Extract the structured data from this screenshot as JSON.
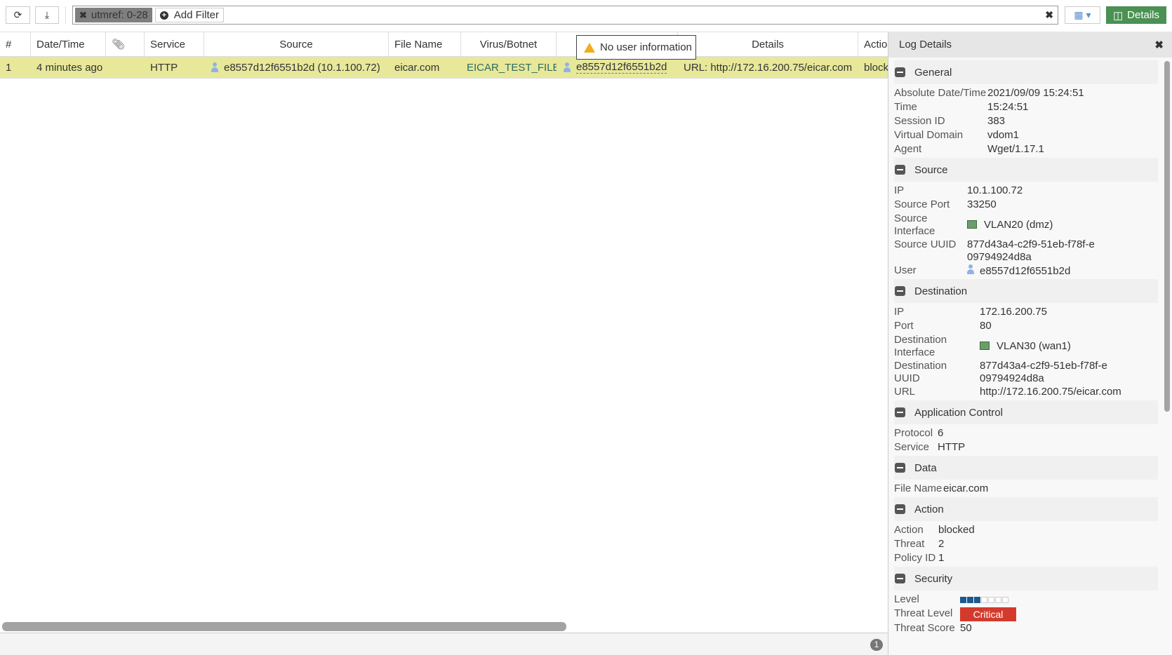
{
  "toolbar": {
    "filter_chip": "utmref: 0-28",
    "add_filter": "Add Filter",
    "details_label": "Details"
  },
  "table": {
    "columns": [
      "#",
      "Date/Time",
      "",
      "Service",
      "Source",
      "File Name",
      "Virus/Botnet",
      "",
      "Details",
      "Actio"
    ],
    "rows": [
      {
        "num": "1",
        "datetime": "4 minutes ago",
        "service": "HTTP",
        "source": "e8557d12f6551b2d (10.1.100.72)",
        "file_name": "eicar.com",
        "virus": "EICAR_TEST_FILE",
        "user": "e8557d12f6551b2d",
        "details": "URL: http://172.16.200.75/eicar.com",
        "action": "block"
      }
    ],
    "tooltip": "No user information",
    "count": "1"
  },
  "panel": {
    "title": "Log Details",
    "general": {
      "title": "General",
      "rows": [
        [
          "Absolute Date/Time",
          "2021/09/09 15:24:51"
        ],
        [
          "Time",
          "15:24:51"
        ],
        [
          "Session ID",
          "383"
        ],
        [
          "Virtual Domain",
          "vdom1"
        ],
        [
          "Agent",
          "Wget/1.17.1"
        ]
      ]
    },
    "source": {
      "title": "Source",
      "ip_l": "IP",
      "ip": "10.1.100.72",
      "port_l": "Source Port",
      "port": "33250",
      "if_l": "Source Interface",
      "if": "VLAN20 (dmz)",
      "uuid_l": "Source UUID",
      "uuid": "877d43a4-c2f9-51eb-f78f-e09794924d8a",
      "user_l": "User",
      "user": "e8557d12f6551b2d"
    },
    "destination": {
      "title": "Destination",
      "ip_l": "IP",
      "ip": "172.16.200.75",
      "port_l": "Port",
      "port": "80",
      "if_l": "Destination Interface",
      "if": "VLAN30 (wan1)",
      "uuid_l": "Destination UUID",
      "uuid": "877d43a4-c2f9-51eb-f78f-e09794924d8a",
      "url_l": "URL",
      "url": "http://172.16.200.75/eicar.com"
    },
    "appctrl": {
      "title": "Application Control",
      "rows": [
        [
          "Protocol",
          "6"
        ],
        [
          "Service",
          "HTTP"
        ]
      ]
    },
    "data": {
      "title": "Data",
      "rows": [
        [
          "File Name",
          "eicar.com"
        ]
      ]
    },
    "action": {
      "title": "Action",
      "rows": [
        [
          "Action",
          "blocked"
        ],
        [
          "Threat",
          "2"
        ],
        [
          "Policy ID",
          "1"
        ]
      ]
    },
    "security": {
      "title": "Security",
      "level_l": "Level",
      "level": 3,
      "level_max": 7,
      "threat_level_l": "Threat Level",
      "threat_level": "Critical",
      "threat_score_l": "Threat Score",
      "threat_score": "50",
      "critical_color": "#d33a2c"
    }
  }
}
